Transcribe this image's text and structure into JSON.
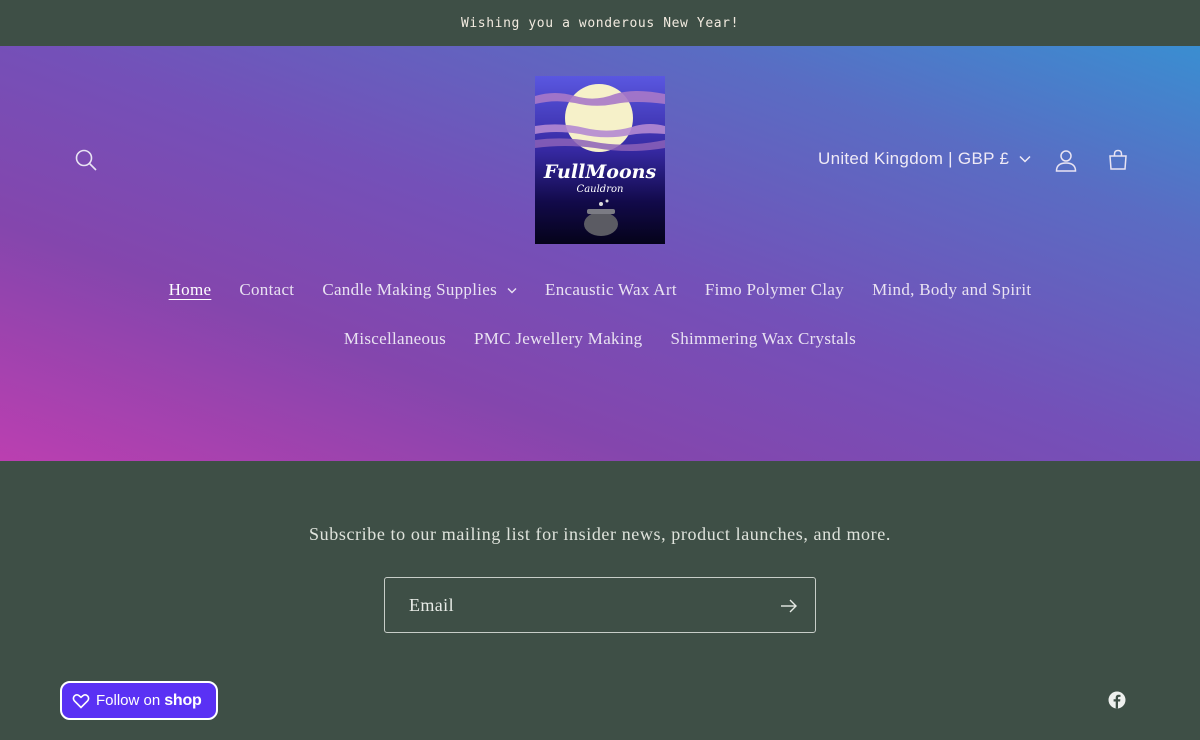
{
  "announcement": {
    "text": "Wishing you a wonderous New Year!"
  },
  "header": {
    "logo": {
      "title": "FullMoons",
      "subtitle": "Cauldron"
    },
    "locale": {
      "label": "United Kingdom | GBP £"
    },
    "icons": [
      "search-icon",
      "account-icon",
      "cart-icon",
      "chevron-down-icon"
    ]
  },
  "nav": {
    "row1": [
      {
        "label": "Home"
      },
      {
        "label": "Contact"
      },
      {
        "label": "Candle Making Supplies"
      },
      {
        "label": "Encaustic Wax Art"
      },
      {
        "label": "Fimo Polymer Clay"
      },
      {
        "label": "Mind, Body and Spirit"
      }
    ],
    "row2": [
      {
        "label": "Miscellaneous"
      },
      {
        "label": "PMC Jewellery Making"
      },
      {
        "label": "Shimmering Wax Crystals"
      }
    ]
  },
  "newsletter": {
    "text": "Subscribe to our mailing list for insider news, product launches, and more.",
    "email_placeholder": "Email",
    "email_value": ""
  },
  "shop_button": {
    "label": "Follow on",
    "brand": "shop"
  },
  "colors": {
    "footer_bg": "#3e4f46",
    "gradient_start": "#3a8ed1",
    "gradient_end": "#bb3fb0",
    "shop_purple": "#5a31f4"
  }
}
